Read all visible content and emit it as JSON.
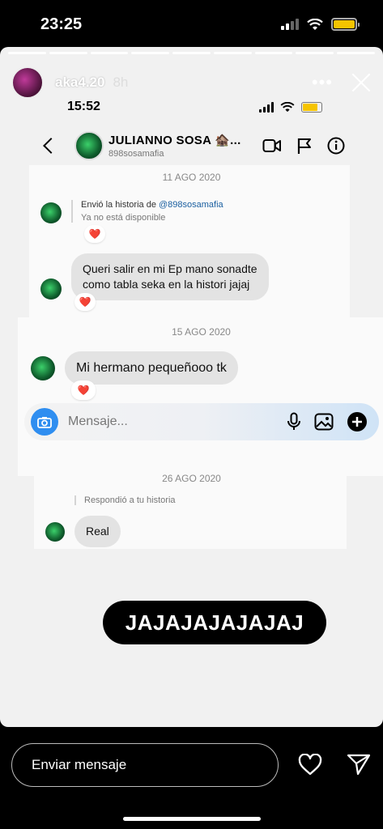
{
  "status_bar": {
    "time": "23:25",
    "battery_color": "#f5c400"
  },
  "story": {
    "username": "aka4.20",
    "age": "8h",
    "more_label": "•••",
    "segments": 9
  },
  "inner_screenshot": {
    "time": "15:52",
    "contact": {
      "name": "JULIANNO SOSA 🏚️...",
      "handle": "898sosamafia"
    },
    "dates": [
      "11 AGO 2020",
      "15 AGO 2020",
      "26 AGO 2020"
    ],
    "story_share": {
      "prefix": "Envió la historia de ",
      "mention": "@898sosamafia",
      "unavailable": "Ya no está disponible"
    },
    "messages": [
      {
        "text": "Queri salir en mi Ep mano sonadte\ncomo tabla seka en la histori jajaj"
      },
      {
        "text": "Mi hermano pequeñooo tk"
      },
      {
        "text": "Real"
      }
    ],
    "reply_note": "Respondió a tu historia",
    "composer_placeholder": "Mensaje...",
    "heart": "❤️"
  },
  "sticker_text": "JAJAJAJAJAJAJ",
  "reply_bar": {
    "placeholder": "Enviar mensaje"
  }
}
